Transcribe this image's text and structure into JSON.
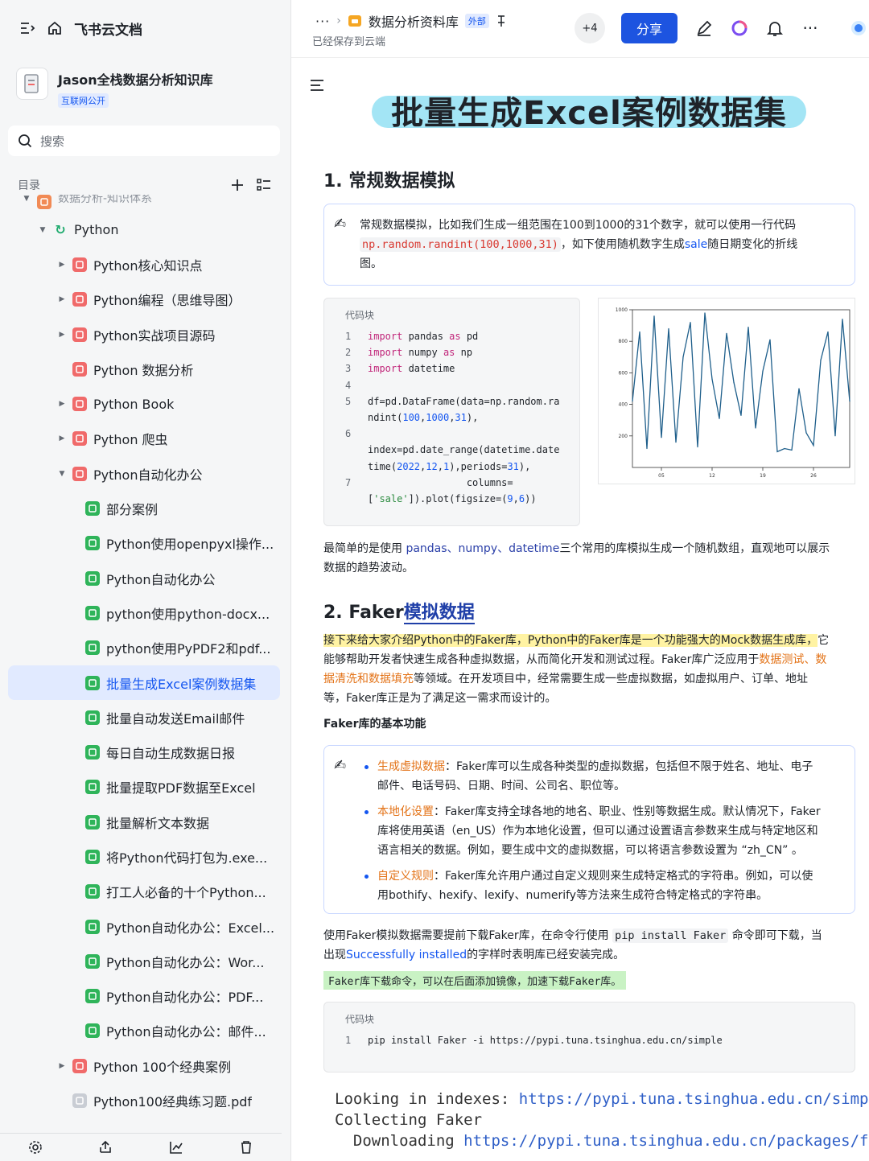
{
  "sidebar": {
    "brand": "飞书云文档",
    "kb_title": "Jason全栈数据分析知识库",
    "kb_badge": "互联网公开",
    "search_label": "搜索",
    "toc_label": "目录",
    "tree": [
      {
        "label": "数据分析-知识体系",
        "level": 0,
        "arrow": "▼",
        "icon": "#f18a55",
        "partial": true
      },
      {
        "label": "Python",
        "level": 1,
        "arrow": "▼",
        "icon": "#1fab6e",
        "glyph": "↻"
      },
      {
        "label": "Python核心知识点",
        "level": 2,
        "arrow": "▶",
        "icon": "#f06a6a"
      },
      {
        "label": "Python编程（思维导图）",
        "level": 2,
        "arrow": "▶",
        "icon": "#f06a6a"
      },
      {
        "label": "Python实战项目源码",
        "level": 2,
        "arrow": "▶",
        "icon": "#f06a6a"
      },
      {
        "label": "Python 数据分析",
        "level": 2,
        "arrow": "",
        "icon": "#f06a6a"
      },
      {
        "label": "Python Book",
        "level": 2,
        "arrow": "▶",
        "icon": "#f06a6a"
      },
      {
        "label": "Python 爬虫",
        "level": 2,
        "arrow": "▶",
        "icon": "#f06a6a"
      },
      {
        "label": "Python自动化办公",
        "level": 2,
        "arrow": "▼",
        "icon": "#f06a6a"
      },
      {
        "label": "部分案例",
        "level": 3,
        "arrow": "",
        "icon": "#2fb45a"
      },
      {
        "label": "Python使用openpyxl操作...",
        "level": 3,
        "arrow": "",
        "icon": "#2fb45a"
      },
      {
        "label": "Python自动化办公",
        "level": 3,
        "arrow": "",
        "icon": "#2fb45a"
      },
      {
        "label": "python使用python-docx...",
        "level": 3,
        "arrow": "",
        "icon": "#2fb45a"
      },
      {
        "label": "python使用PyPDF2和pdf...",
        "level": 3,
        "arrow": "",
        "icon": "#2fb45a"
      },
      {
        "label": "批量生成Excel案例数据集",
        "level": 3,
        "arrow": "",
        "icon": "#2fb45a",
        "selected": true
      },
      {
        "label": "批量自动发送Email邮件",
        "level": 3,
        "arrow": "",
        "icon": "#2fb45a"
      },
      {
        "label": "每日自动生成数据日报",
        "level": 3,
        "arrow": "",
        "icon": "#2fb45a"
      },
      {
        "label": "批量提取PDF数据至Excel",
        "level": 3,
        "arrow": "",
        "icon": "#2fb45a"
      },
      {
        "label": "批量解析文本数据",
        "level": 3,
        "arrow": "",
        "icon": "#2fb45a"
      },
      {
        "label": "将Python代码打包为.exe...",
        "level": 3,
        "arrow": "",
        "icon": "#2fb45a"
      },
      {
        "label": "打工人必备的十个Python...",
        "level": 3,
        "arrow": "",
        "icon": "#2fb45a"
      },
      {
        "label": "Python自动化办公：Excel...",
        "level": 3,
        "arrow": "",
        "icon": "#2fb45a"
      },
      {
        "label": "Python自动化办公：Wor...",
        "level": 3,
        "arrow": "",
        "icon": "#2fb45a"
      },
      {
        "label": "Python自动化办公：PDF...",
        "level": 3,
        "arrow": "",
        "icon": "#2fb45a"
      },
      {
        "label": "Python自动化办公：邮件...",
        "level": 3,
        "arrow": "",
        "icon": "#2fb45a"
      },
      {
        "label": "Python 100个经典案例",
        "level": 2,
        "arrow": "▶",
        "icon": "#f06a6a"
      },
      {
        "label": "Python100经典练习题.pdf",
        "level": 2,
        "arrow": "",
        "icon": "#c9cdd4"
      }
    ]
  },
  "topbar": {
    "breadcrumb_title": "数据分析资料库",
    "external_badge": "外部",
    "saved": "已经保存到云端",
    "collab_count": "+4",
    "share": "分享"
  },
  "doc": {
    "title": "批量生成Excel案例数据集",
    "h1": "1. 常规数据模拟",
    "c1_a": "常规数据模拟，比如我们生成一组范围在100到1000的31个数字，就可以使用一行代码",
    "c1_code": "np.random.randint(100,1000,31)",
    "c1_b": "，如下使用随机数字生成",
    "c1_sale": "sale",
    "c1_c": "随日期变化的折线",
    "c1_d": "图。",
    "code_label": "代码块",
    "code_lines": [
      {
        "n": "1",
        "t": "import pandas as pd"
      },
      {
        "n": "2",
        "t": "import numpy as np"
      },
      {
        "n": "3",
        "t": "import datetime"
      },
      {
        "n": "4",
        "t": ""
      },
      {
        "n": "5",
        "t": "df=pd.DataFrame(data=np.random.ra"
      },
      {
        "n": "",
        "t": "ndint(100,1000,31),"
      },
      {
        "n": "6",
        "t": ""
      },
      {
        "n": "",
        "t": "index=pd.date_range(datetime.date"
      },
      {
        "n": "",
        "t": "time(2022,12,1),periods=31),"
      },
      {
        "n": "7",
        "t": "                 columns="
      },
      {
        "n": "",
        "t": "['sale']).plot(figsize=(9,6))"
      }
    ],
    "p1_a": "最简单的是使用 ",
    "p1_libs": "pandas、numpy、datetime",
    "p1_b": "三个常用的库模拟生成一个随机数组，直观地可以展示",
    "p1_c": "数据的趋势波动。",
    "h2_a": "2. Faker",
    "h2_b": "模拟数据",
    "p2_hl": "接下来给大家介绍Python中的Faker库，Python中的Faker库是一个功能强大的Mock数据生成库，",
    "p2_a": "它",
    "p2_b": "能够帮助开发者快速生成各种虚拟数据，从而简化开发和测试过程。Faker库广泛应用于",
    "p2_o1": "数据测试、数",
    "p2_o2": "据清洗和数据填充",
    "p2_c": "等领域。在开发项目中，经常需要生成一些虚拟数据，如虚拟用户、订单、地址",
    "p2_d": "等，Faker库正是为了满足这一需求而设计的。",
    "h3": "Faker库的基本功能",
    "b1_t": "生成虚拟数据",
    "b1_a": "：Faker库可以生成各种类型的虚拟数据，包括但不限于姓名、地址、电子",
    "b1_b": "邮件、电话号码、日期、时间、公司名、职位等。",
    "b2_t": "本地化设置",
    "b2_a": "：Faker库支持全球各地的地名、职业、性别等数据生成。默认情况下，Faker",
    "b2_b": "库将使用英语（en_US）作为本地化设置，但可以通过设置语言参数来生成与特定地区和",
    "b2_c": "语言相关的数据。例如，要生成中文的虚拟数据，可以将语言参数设置为 “zh_CN” 。",
    "b3_t": "自定义规则",
    "b3_a": "：Faker库允许用户通过自定义规则来生成特定格式的字符串。例如，可以使",
    "b3_b": "用bothify、hexify、lexify、numerify等方法来生成符合特定格式的字符串。",
    "p3_a": "使用Faker模拟数据需要提前下载Faker库，在命令行使用 ",
    "p3_code": "pip install Faker",
    "p3_b": " 命令即可下载，当",
    "p3_c": "出现",
    "p3_succ": "Successfully installed",
    "p3_d": "的字样时表明库已经安装完成。",
    "green_note": "Faker库下载命令，可以在后面添加镜像，加速下载Faker库。",
    "code2_label": "代码块",
    "code2_line": "pip install Faker -i https://pypi.tuna.tsinghua.edu.cn/simple",
    "term1_a": "Looking in indexes: ",
    "term1_link": "https://pypi.tuna.tsinghua.edu.cn/simple",
    "term2": "Collecting Faker",
    "term3_a": "  Downloading ",
    "term3_link": "https://pypi.tuna.tsinghua.edu.cn/packages/f0/2"
  },
  "chart_data": {
    "type": "line",
    "ylim": [
      0,
      1000
    ],
    "yticks": [
      200,
      400,
      600,
      800,
      1000
    ],
    "xticks": [
      "05",
      "12",
      "19",
      "26"
    ],
    "x": [
      "2022-12-01",
      "2022-12-02",
      "2022-12-03",
      "2022-12-04",
      "2022-12-05",
      "2022-12-06",
      "2022-12-07",
      "2022-12-08",
      "2022-12-09",
      "2022-12-10",
      "2022-12-11",
      "2022-12-12",
      "2022-12-13",
      "2022-12-14",
      "2022-12-15",
      "2022-12-16",
      "2022-12-17",
      "2022-12-18",
      "2022-12-19",
      "2022-12-20",
      "2022-12-21",
      "2022-12-22",
      "2022-12-23",
      "2022-12-24",
      "2022-12-25",
      "2022-12-26",
      "2022-12-27",
      "2022-12-28",
      "2022-12-29",
      "2022-12-30",
      "2022-12-31"
    ],
    "values": [
      420,
      860,
      120,
      960,
      190,
      880,
      160,
      700,
      920,
      130,
      980,
      560,
      310,
      850,
      540,
      330,
      890,
      250,
      610,
      810,
      100,
      120,
      110,
      500,
      220,
      140,
      680,
      860,
      200,
      940,
      420
    ],
    "color": "#1f5f8b"
  }
}
